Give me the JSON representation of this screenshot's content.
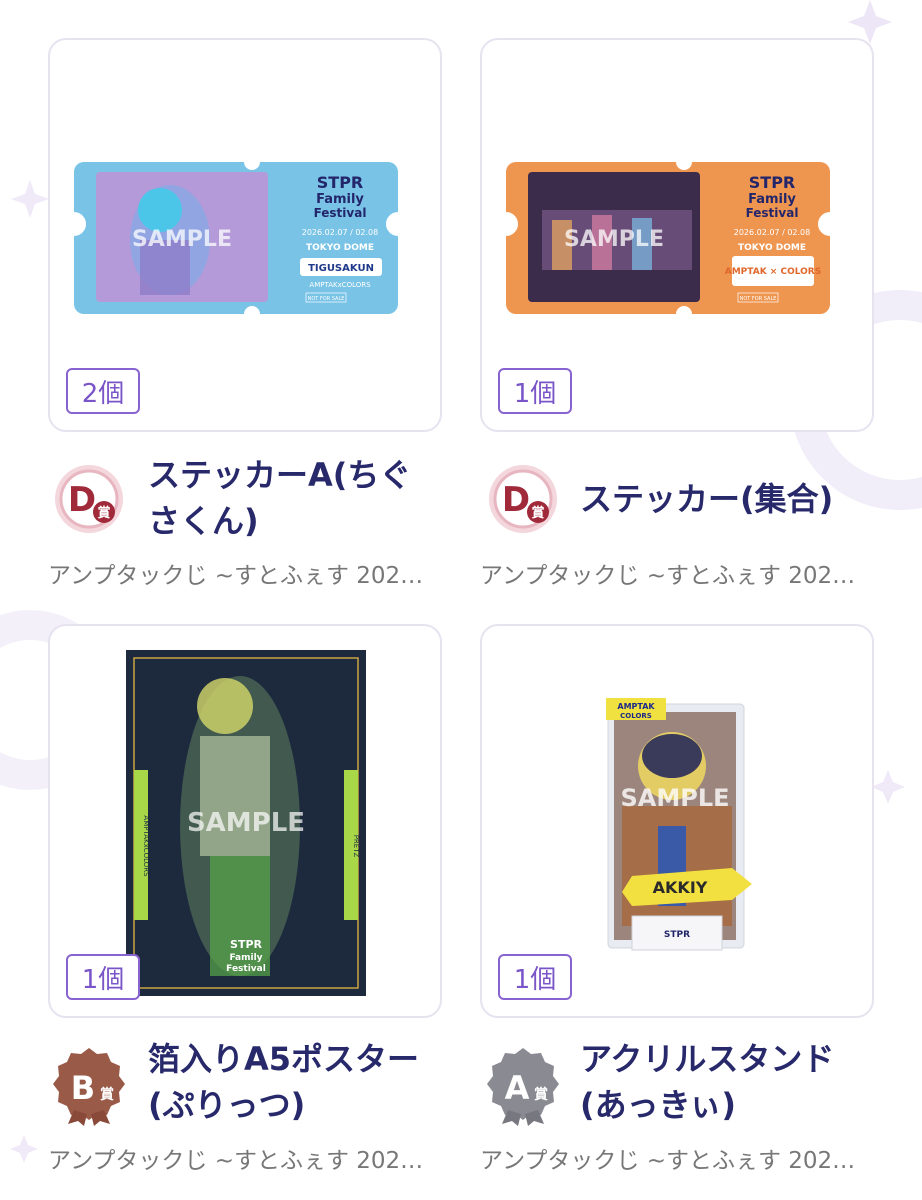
{
  "items": [
    {
      "quantity": "2個",
      "grade_letter": "D",
      "grade_suffix": "賞",
      "title": "ステッカーA(ちぐさくん)",
      "subtitle": "アンプタックじ ~すとふぇす 202…",
      "art": {
        "watermark": "SAMPLE",
        "logo": "2026 STPR Family Festival",
        "date": "2026.02.07 / 02.08",
        "venue": "TOKYO DOME",
        "name": "TIGUSAKUN",
        "unit": "AMPTAKxCOLORS",
        "nfs": "NOT FOR SALE"
      }
    },
    {
      "quantity": "1個",
      "grade_letter": "D",
      "grade_suffix": "賞",
      "title": "ステッカー(集合)",
      "subtitle": "アンプタックじ ~すとふぇす 202…",
      "art": {
        "watermark": "SAMPLE",
        "logo": "2026 STPR Family Festival",
        "date": "2026.02.07 / 02.08",
        "venue": "TOKYO DOME",
        "name": "AMPTAK × COLORS",
        "nfs": "NOT FOR SALE"
      }
    },
    {
      "quantity": "1個",
      "grade_letter": "B",
      "grade_suffix": "賞",
      "title": "箔入りA5ポスター(ぷりっつ)",
      "subtitle": "アンプタックじ ~すとふぇす 202…",
      "art": {
        "watermark": "SAMPLE",
        "left_tag": "AMPTAKxCOLORS",
        "right_tag": "PRETZ",
        "logo": "STPR Family Festival"
      }
    },
    {
      "quantity": "1個",
      "grade_letter": "A",
      "grade_suffix": "賞",
      "title": "アクリルスタンド(あっきぃ)",
      "subtitle": "アンプタックじ ~すとふぇす 202…",
      "art": {
        "watermark": "SAMPLE",
        "tag_top": "AMPTAK",
        "tag_bottom": "COLORS",
        "name": "AKKIY",
        "logo": "STPR"
      }
    }
  ],
  "colors": {
    "title": "#27296b",
    "qty_border": "#8a63d2",
    "d_badge": "#a02a3a",
    "b_badge": "#8a4a3a",
    "a_badge": "#7a7a82"
  }
}
